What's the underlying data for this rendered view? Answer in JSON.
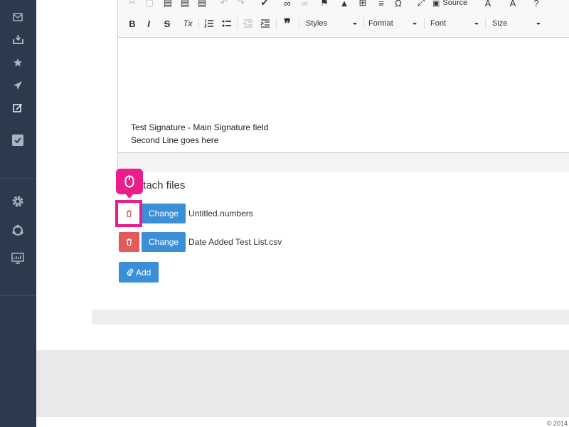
{
  "sidebar": {
    "items": [
      {
        "icon": "inbox-icon"
      },
      {
        "icon": "download-tray-icon"
      },
      {
        "icon": "star-icon"
      },
      {
        "icon": "send-icon"
      },
      {
        "icon": "compose-icon"
      },
      {
        "icon": "checkbox-icon"
      },
      {
        "icon": "gear-icon"
      },
      {
        "icon": "network-icon"
      },
      {
        "icon": "monitor-chart-icon"
      }
    ]
  },
  "editor": {
    "toolbar": {
      "source_label": "Source",
      "styles_label": "Styles",
      "format_label": "Format",
      "font_label": "Font",
      "size_label": "Size",
      "bold_label": "B",
      "italic_label": "I",
      "strike_label": "S",
      "clear_label": "Tx",
      "quote_label": "❞",
      "help_label": "?"
    },
    "signature_lines": [
      "Test Signature - Main Signature field",
      "Second Line goes here"
    ]
  },
  "attachments": {
    "title": "Attach files",
    "files": [
      {
        "change_label": "Change",
        "name": "Untitled.numbers"
      },
      {
        "change_label": "Change",
        "name": "Date Added Test List.csv"
      }
    ],
    "add_label": "Add"
  },
  "footer": {
    "copyright": "© 2014"
  },
  "colors": {
    "sidebar": "#2b3a4d",
    "danger": "#e25a5a",
    "primary": "#3a8fd6",
    "highlight": "#ea1d8a"
  }
}
